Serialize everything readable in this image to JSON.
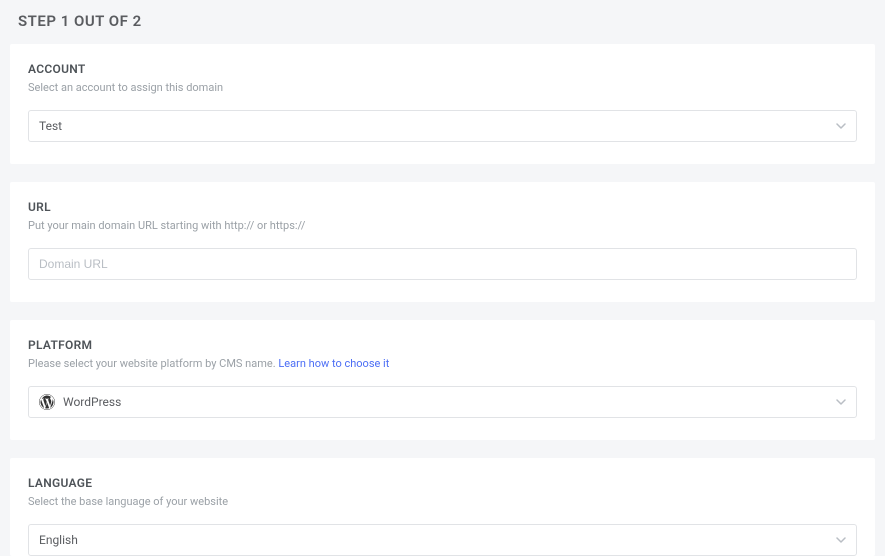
{
  "page": {
    "title": "STEP 1 OUT OF 2"
  },
  "account": {
    "label": "ACCOUNT",
    "hint": "Select an account to assign this domain",
    "selected": "Test"
  },
  "url": {
    "label": "URL",
    "hint": "Put your main domain URL starting with http:// or https://",
    "placeholder": "Domain URL",
    "value": ""
  },
  "platform": {
    "label": "PLATFORM",
    "hint_prefix": "Please select your website platform by CMS name.  ",
    "hint_link": "Learn how to choose it",
    "selected": "WordPress"
  },
  "language": {
    "label": "LANGUAGE",
    "hint": "Select the base language of your website",
    "selected": "English"
  }
}
